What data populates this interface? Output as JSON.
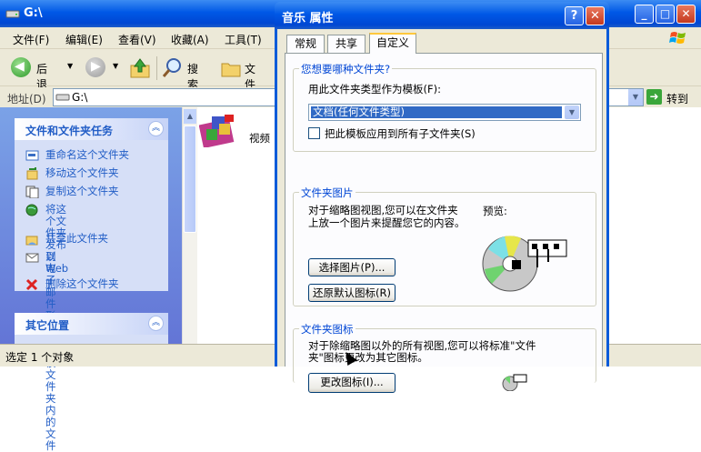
{
  "explorer": {
    "title": "G:\\",
    "menu": [
      "文件(F)",
      "编辑(E)",
      "查看(V)",
      "收藏(A)",
      "工具(T)"
    ],
    "toolbar": {
      "back": "后退",
      "search": "搜索",
      "folders": "文件夹"
    },
    "address": {
      "label": "地址(D)",
      "value": "G:\\",
      "go": "转到"
    },
    "tasks_panel": {
      "title": "文件和文件夹任务",
      "items": [
        "重命名这个文件夹",
        "移动这个文件夹",
        "复制这个文件夹",
        "将这个文件夹发布到\nWeb",
        "共享此文件夹",
        "以电子邮件形式发送\n该文件夹内的文件",
        "删除这个文件夹"
      ]
    },
    "other_places": {
      "title": "其它位置"
    },
    "content": {
      "items": [
        "视频"
      ]
    },
    "status": "选定 1 个对象"
  },
  "dialog": {
    "title": "音乐 属性",
    "tabs": [
      "常规",
      "共享",
      "自定义"
    ],
    "active_tab": "自定义",
    "group1": {
      "title": "您想要哪种文件夹?",
      "template_label": "用此文件夹类型作为模板(F):",
      "template_value": "文档(任何文件类型)",
      "apply_sub": "把此模板应用到所有子文件夹(S)",
      "apply_sub_checked": false
    },
    "group2": {
      "title": "文件夹图片",
      "desc": "对于缩略图视图,您可以在文件夹\n上放一个图片来提醒您它的内容。",
      "preview": "预览:",
      "choose_button": "选择图片(P)...",
      "restore_button": "还原默认图标(R)"
    },
    "group3": {
      "title": "文件夹图标",
      "desc": "对于除缩略图以外的所有视图,您可以将标准\"文件\n夹\"图标更改为其它图标。",
      "change_button": "更改图标(I)..."
    }
  },
  "colors": {
    "xp_blue": "#0058E6",
    "task_link": "#215DC6"
  }
}
